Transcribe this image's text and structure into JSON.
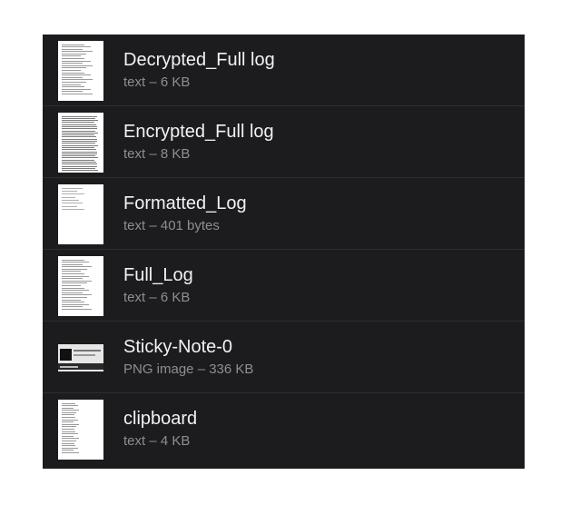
{
  "files": [
    {
      "name": "Decrypted_Full log",
      "info": "text – 6 KB",
      "icon": "text-file-thumbnail"
    },
    {
      "name": "Encrypted_Full log",
      "info": "text – 8 KB",
      "icon": "text-file-thumbnail"
    },
    {
      "name": "Formatted_Log",
      "info": "text – 401 bytes",
      "icon": "text-file-thumbnail"
    },
    {
      "name": "Full_Log",
      "info": "text – 6 KB",
      "icon": "text-file-thumbnail"
    },
    {
      "name": "Sticky-Note-0",
      "info": "PNG image – 336 KB",
      "icon": "png-image-thumbnail"
    },
    {
      "name": "clipboard",
      "info": "text – 4 KB",
      "icon": "text-file-thumbnail"
    }
  ],
  "colors": {
    "background": "#1c1c1e",
    "primary_text": "#f2f2f2",
    "secondary_text": "#8e8e93",
    "separator": "#2e2e31"
  }
}
